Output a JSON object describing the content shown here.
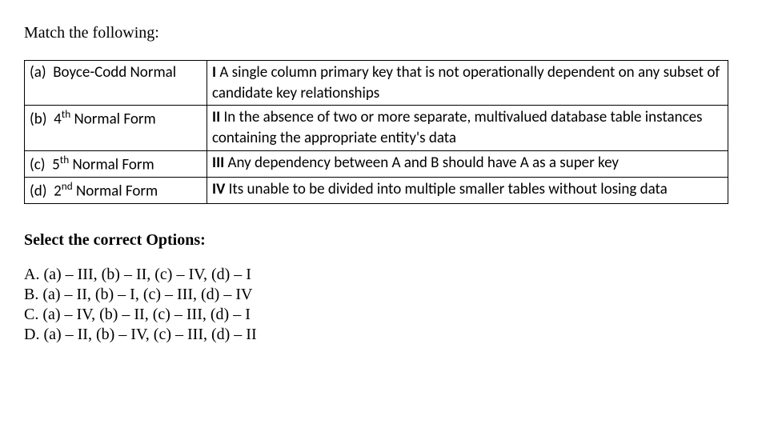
{
  "prompt": "Match the following:",
  "table": {
    "rows": [
      {
        "left_label": "(a)",
        "left_text": "Boyce-Codd Normal",
        "left_sup": "",
        "right_num": "I",
        "right_text": "A single column primary key that is not operationally dependent on any subset of candidate key relationships"
      },
      {
        "left_label": "(b)",
        "left_text": "Normal Form",
        "left_sup": "4th",
        "right_num": "II",
        "right_text": "In the absence of two or more separate, multivalued database table instances containing the appropriate entity's data"
      },
      {
        "left_label": "(c)",
        "left_text": "Normal Form",
        "left_sup": "5th",
        "right_num": "III",
        "right_text": "Any dependency between A and B should have A as a super key"
      },
      {
        "left_label": "(d)",
        "left_text": "Normal Form",
        "left_sup": "2nd",
        "right_num": "IV",
        "right_text": "Its unable to be divided into multiple smaller tables without losing data"
      }
    ]
  },
  "options_heading": "Select the correct Options:",
  "options": [
    "A. (a) – III, (b) – II, (c) – IV, (d) – I",
    "B. (a) – II, (b) – I, (c) – III, (d) – IV",
    "C. (a) – IV, (b) – II, (c) – III, (d) – I",
    "D. (a) – II, (b) – IV, (c) – III, (d) – II"
  ]
}
